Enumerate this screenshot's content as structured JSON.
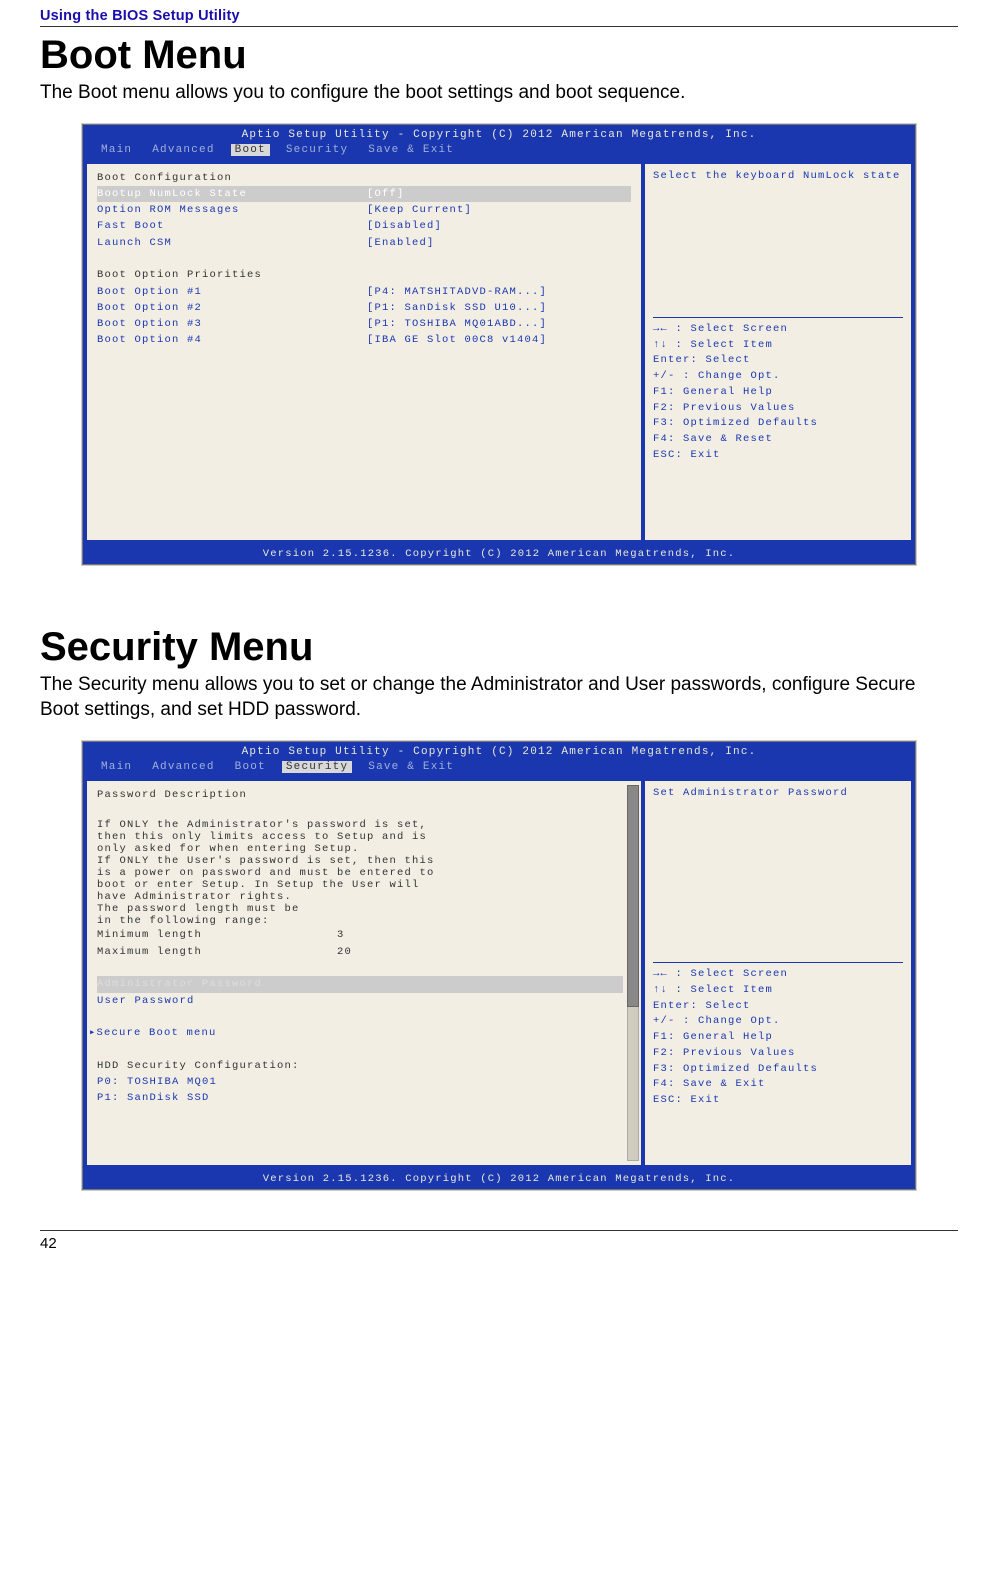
{
  "page": {
    "header_section": "Using the BIOS Setup Utility",
    "page_number": "42"
  },
  "section1": {
    "title": "Boot Menu",
    "intro": "The Boot menu allows you to configure the boot settings and boot sequence."
  },
  "section2": {
    "title": "Security Menu",
    "intro": "The Security menu allows you to set or change the Administrator and User passwords, configure Secure Boot settings, and set HDD password."
  },
  "bios_common": {
    "title": "Aptio Setup Utility - Copyright (C) 2012 American Megatrends, Inc.",
    "footer": "Version 2.15.1236. Copyright (C) 2012 American Megatrends, Inc.",
    "tabs": [
      "Main",
      "Advanced",
      "Boot",
      "Security",
      "Save & Exit"
    ],
    "help_lines": {
      "arrows_lr": "→← : Select Screen",
      "arrows_ud": "↑↓ : Select Item",
      "enter": "Enter: Select",
      "pm": "+/- : Change Opt.",
      "f1": "F1: General Help",
      "f2": "F2: Previous Values",
      "f3": "F3: Optimized Defaults",
      "f4": "F4: Save & Reset",
      "esc": "ESC: Exit"
    }
  },
  "bios_boot": {
    "active_tab": "Boot",
    "help_text": "Select the keyboard NumLock state",
    "group1_heading": "Boot Configuration",
    "rows1": [
      {
        "label": "Bootup NumLock State",
        "value": "[Off]",
        "selected": true
      },
      {
        "label": "Option ROM Messages",
        "value": "[Keep Current]"
      },
      {
        "label": "Fast Boot",
        "value": "[Disabled]"
      },
      {
        "label": "Launch CSM",
        "value": "[Enabled]"
      }
    ],
    "group2_heading": "Boot Option Priorities",
    "rows2": [
      {
        "label": "Boot Option #1",
        "value": "[P4: MATSHITADVD-RAM...]"
      },
      {
        "label": "Boot Option #2",
        "value": "[P1: SanDisk  SSD  U10...]"
      },
      {
        "label": "Boot Option #3",
        "value": "[P1: TOSHIBA MQ01ABD...]"
      },
      {
        "label": "Boot Option #4",
        "value": "[IBA GE Slot 00C8 v1404]"
      }
    ],
    "help_lines_f4": "F4: Save & Reset"
  },
  "bios_security": {
    "active_tab": "Security",
    "help_text": "Set Administrator Password",
    "heading1": "Password Description",
    "desc_lines": [
      "If ONLY the Administrator's password is set,",
      "then this only limits access to Setup and is",
      "only asked for when entering Setup.",
      "If ONLY the User's password is set, then this",
      "is a power on password and must be entered to",
      "boot or enter Setup. In Setup the User will",
      "have Administrator rights.",
      "The password length must be",
      "in the following range:"
    ],
    "min_label": "Minimum length",
    "min_val": "3",
    "max_label": "Maximum length",
    "max_val": "20",
    "admin_pw": "Administrator Password",
    "user_pw": "User Password",
    "secure_boot": "Secure Boot menu",
    "hdd_heading": "HDD Security Configuration:",
    "hdd1": "P0: TOSHIBA MQ01",
    "hdd2": "P1: SanDisk SSD",
    "help_lines_f4": "F4: Save & Exit"
  }
}
